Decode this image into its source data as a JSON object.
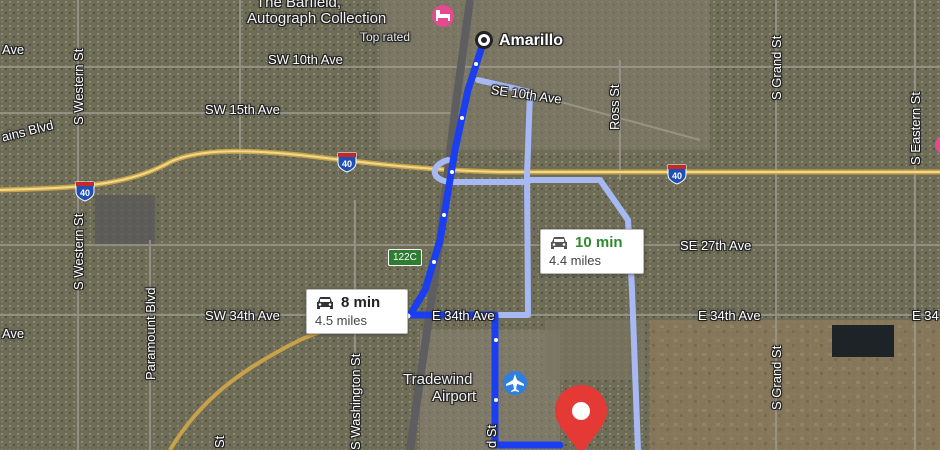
{
  "map": {
    "route_color": "#1a3ef0",
    "alt_route_color": "#a7b9f4",
    "destination_pin_color": "#e53935"
  },
  "labels": {
    "city": "Amarillo",
    "hotel_line1": "The Barfield,",
    "hotel_line2": "Autograph Collection",
    "hotel_note": "Top rated",
    "airport_line1": "Tradewind",
    "airport_line2": "Airport",
    "sw_10th": "SW 10th Ave",
    "se_10th": "SE 10th Ave",
    "sw_15th": "SW 15th Ave",
    "plains_blvd": "ains Blvd",
    "ave_left_top": "Ave",
    "ave_left_mid": "Ave",
    "se_27th": "SE 27th Ave",
    "sw_34th": "SW 34th Ave",
    "e_34th_a": "E 34th Ave",
    "e_34th_b": "E 34th Ave",
    "e_34th_c": "E 34",
    "s_western_top": "S Western St",
    "s_western_bot": "S Western St",
    "paramount": "Paramount Blvd",
    "s_washington": "S Washington St",
    "ross_st": "Ross St",
    "s_grand_top": "S Grand St",
    "s_grand_bot": "S Grand St",
    "s_eastern": "S Eastern St",
    "st_bottom": "St",
    "d_st": "d St"
  },
  "shields": [
    "40",
    "40",
    "40"
  ],
  "exit_sign": "122C",
  "routes": [
    {
      "time": "8 min",
      "distance": "4.5 miles",
      "selected": true
    },
    {
      "time": "10 min",
      "distance": "4.4 miles",
      "selected": false
    }
  ],
  "icons": {
    "car": "car-icon",
    "airport": "airplane-icon",
    "hotel": "bed-icon",
    "origin": "origin-marker-icon",
    "destination": "destination-pin-icon"
  }
}
